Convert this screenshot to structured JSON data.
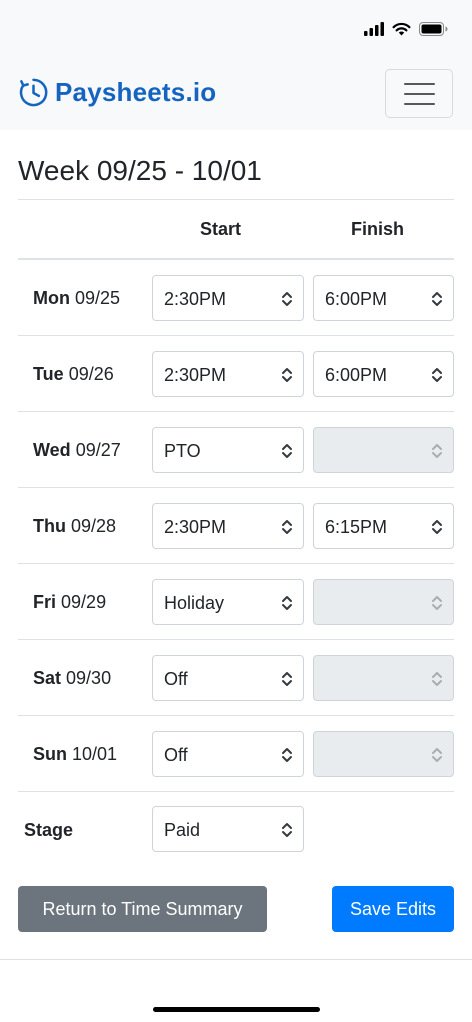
{
  "brand": {
    "name": "Paysheets.io",
    "color": "#1565c0"
  },
  "week": {
    "title": "Week 09/25 - 10/01"
  },
  "columns": {
    "start": "Start",
    "finish": "Finish"
  },
  "days": [
    {
      "day": "Mon",
      "date": "09/25",
      "start": "2:30PM",
      "finish": "6:00PM",
      "finish_disabled": false
    },
    {
      "day": "Tue",
      "date": "09/26",
      "start": "2:30PM",
      "finish": "6:00PM",
      "finish_disabled": false
    },
    {
      "day": "Wed",
      "date": "09/27",
      "start": "PTO",
      "finish": "",
      "finish_disabled": true
    },
    {
      "day": "Thu",
      "date": "09/28",
      "start": "2:30PM",
      "finish": "6:15PM",
      "finish_disabled": false
    },
    {
      "day": "Fri",
      "date": "09/29",
      "start": "Holiday",
      "finish": "",
      "finish_disabled": true
    },
    {
      "day": "Sat",
      "date": "09/30",
      "start": "Off",
      "finish": "",
      "finish_disabled": true
    },
    {
      "day": "Sun",
      "date": "10/01",
      "start": "Off",
      "finish": "",
      "finish_disabled": true
    }
  ],
  "stage": {
    "label": "Stage",
    "value": "Paid"
  },
  "buttons": {
    "return": "Return to Time Summary",
    "save": "Save Edits"
  },
  "colors": {
    "primary": "#007bff",
    "secondary": "#6c757d",
    "disabled_bg": "#e9ecef"
  }
}
